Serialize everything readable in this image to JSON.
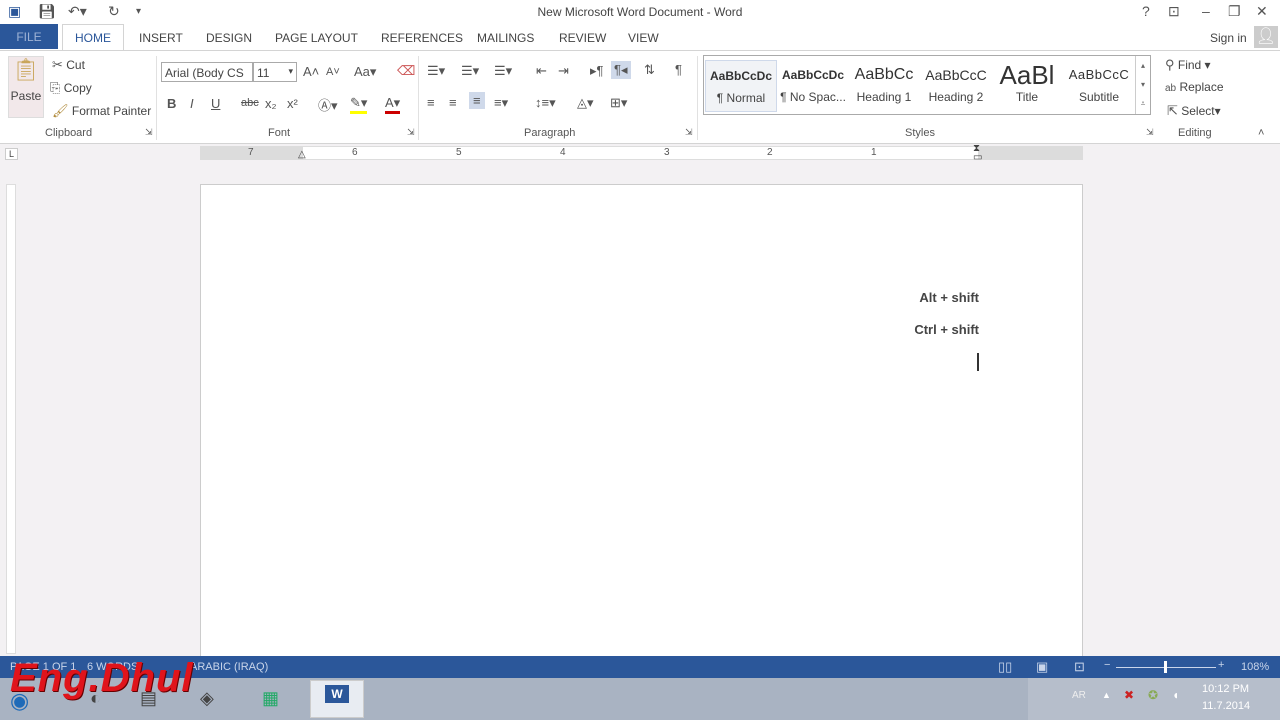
{
  "window": {
    "title": "New Microsoft Word Document - Word",
    "help": "?",
    "sign_in": "Sign in"
  },
  "tabs": [
    "FILE",
    "HOME",
    "INSERT",
    "DESIGN",
    "PAGE LAYOUT",
    "REFERENCES",
    "MAILINGS",
    "REVIEW",
    "VIEW"
  ],
  "clipboard": {
    "paste": "Paste",
    "cut": "Cut",
    "copy": "Copy",
    "format_painter": "Format Painter",
    "label": "Clipboard"
  },
  "font": {
    "name": "Arial (Body CS",
    "size": "11",
    "label": "Font",
    "bold": "B",
    "italic": "I",
    "underline": "U",
    "strike": "abc",
    "sub": "x₂",
    "sup": "x²",
    "case": "Aa"
  },
  "paragraph": {
    "label": "Paragraph",
    "pilcrow": "¶"
  },
  "styles": {
    "label": "Styles",
    "items": [
      {
        "preview": "AaBbCcDc",
        "name": "¶ Normal"
      },
      {
        "preview": "AaBbCcDc",
        "name": "¶ No Spac..."
      },
      {
        "preview": "AaBbCc",
        "name": "Heading 1"
      },
      {
        "preview": "AaBbCcC",
        "name": "Heading 2"
      },
      {
        "preview": "AaBl",
        "name": "Title"
      },
      {
        "preview": "AaBbCcC",
        "name": "Subtitle"
      }
    ]
  },
  "editing": {
    "label": "Editing",
    "find": "Find",
    "replace": "Replace",
    "select": "Select"
  },
  "ruler": {
    "numbers": [
      "7",
      "6",
      "5",
      "4",
      "3",
      "2",
      "1"
    ]
  },
  "document": {
    "lines": [
      "Alt + shift",
      "Ctrl + shift"
    ]
  },
  "status": {
    "page": "PAGE 1 OF 1",
    "words": "6 WORDS",
    "language": "ARABIC (IRAQ)",
    "zoom": "108%"
  },
  "taskbar": {
    "lang": "AR",
    "time": "10:12 PM",
    "date": "11.7.2014"
  },
  "watermark": "Eng.Dhul",
  "colors": {
    "accent": "#2b579a"
  }
}
